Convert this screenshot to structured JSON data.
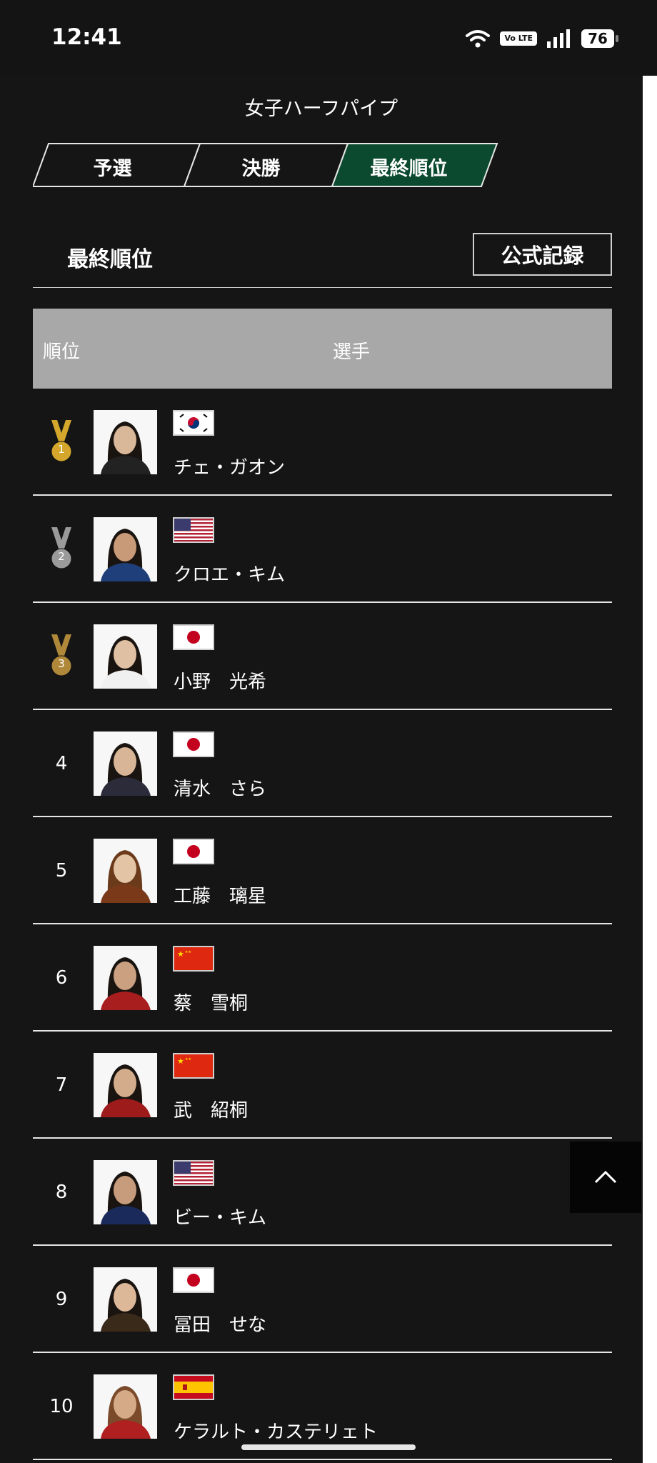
{
  "status_bar": {
    "time": "12:41",
    "volte": "Vo LTE",
    "battery": "76"
  },
  "page_title": "女子ハーフパイプ",
  "tabs": [
    {
      "label": "予選",
      "active": false
    },
    {
      "label": "決勝",
      "active": false
    },
    {
      "label": "最終順位",
      "active": true
    }
  ],
  "section": {
    "title": "最終順位",
    "official_record_button": "公式記録"
  },
  "table": {
    "header": {
      "rank": "順位",
      "player": "選手"
    },
    "rows": [
      {
        "rank": "1",
        "medal": "gold",
        "flag": "kr",
        "name": "チェ・ガオン"
      },
      {
        "rank": "2",
        "medal": "silver",
        "flag": "us",
        "name": "クロエ・キム"
      },
      {
        "rank": "3",
        "medal": "bronze",
        "flag": "jp",
        "name": "小野　光希"
      },
      {
        "rank": "4",
        "medal": null,
        "flag": "jp",
        "name": "清水　さら"
      },
      {
        "rank": "5",
        "medal": null,
        "flag": "jp",
        "name": "工藤　璃星"
      },
      {
        "rank": "6",
        "medal": null,
        "flag": "cn",
        "name": "蔡　雪桐"
      },
      {
        "rank": "7",
        "medal": null,
        "flag": "cn",
        "name": "武　紹桐"
      },
      {
        "rank": "8",
        "medal": null,
        "flag": "us",
        "name": "ビー・キム"
      },
      {
        "rank": "9",
        "medal": null,
        "flag": "jp",
        "name": "冨田　せな"
      },
      {
        "rank": "10",
        "medal": null,
        "flag": "es",
        "name": "ケラルト・カステリェト"
      }
    ]
  },
  "colors": {
    "background": "#151515",
    "active_tab": "#0b4a2e",
    "table_header": "#a8a8a8",
    "gold": "#d4a72c",
    "silver": "#9a9a9a",
    "bronze": "#b0883a"
  }
}
